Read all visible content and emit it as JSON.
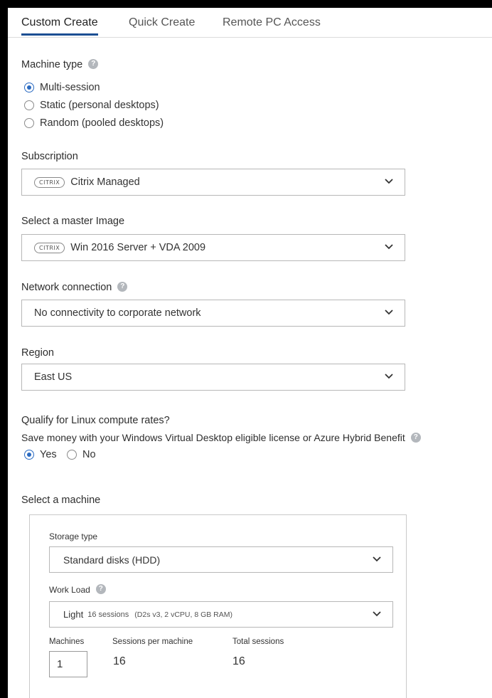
{
  "tabs": [
    {
      "label": "Custom Create",
      "active": true
    },
    {
      "label": "Quick Create",
      "active": false
    },
    {
      "label": "Remote PC Access",
      "active": false
    }
  ],
  "machine_type": {
    "label": "Machine type",
    "options": [
      {
        "label": "Multi-session",
        "checked": true
      },
      {
        "label": "Static (personal desktops)",
        "checked": false
      },
      {
        "label": "Random (pooled desktops)",
        "checked": false
      }
    ]
  },
  "subscription": {
    "label": "Subscription",
    "badge": "CITRIX",
    "value": "Citrix Managed"
  },
  "master_image": {
    "label": "Select a master Image",
    "badge": "CITRIX",
    "value": "Win 2016 Server + VDA 2009"
  },
  "network": {
    "label": "Network connection",
    "value": "No connectivity to corporate network"
  },
  "region": {
    "label": "Region",
    "value": "East US"
  },
  "linux_rates": {
    "title": "Qualify for Linux compute rates?",
    "description": "Save money with your Windows Virtual Desktop eligible license or Azure Hybrid Benefit",
    "options": [
      {
        "label": "Yes",
        "checked": true
      },
      {
        "label": "No",
        "checked": false
      }
    ]
  },
  "select_machine": {
    "label": "Select a machine",
    "storage_type": {
      "label": "Storage type",
      "value": "Standard disks (HDD)"
    },
    "workload": {
      "label": "Work Load",
      "name": "Light",
      "sessions": "16 sessions",
      "spec": "(D2s v3, 2 vCPU, 8 GB RAM)"
    },
    "machines": {
      "label": "Machines",
      "value": "1"
    },
    "sessions_per_machine": {
      "label": "Sessions per machine",
      "value": "16"
    },
    "total_sessions": {
      "label": "Total sessions",
      "value": "16"
    }
  },
  "colors": {
    "accent": "#1c4f93",
    "radio": "#2a6ac1",
    "help_icon": "#b3b7bc"
  },
  "icons": [
    "help-icon",
    "chevron-down-icon",
    "citrix-badge"
  ]
}
